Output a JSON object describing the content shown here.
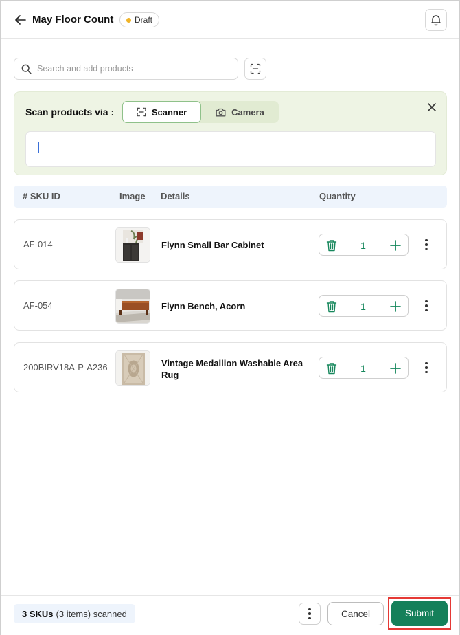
{
  "header": {
    "title": "May Floor Count",
    "status": "Draft",
    "status_color": "#f0b429"
  },
  "search": {
    "placeholder": "Search and add products"
  },
  "scan": {
    "label": "Scan products via :",
    "options": [
      "Scanner",
      "Camera"
    ],
    "selected": "Scanner",
    "input_value": ""
  },
  "table": {
    "headers": [
      "# SKU ID",
      "Image",
      "Details",
      "Quantity"
    ],
    "rows": [
      {
        "sku": "AF-014",
        "name": "Flynn Small Bar Cabinet",
        "qty": "1"
      },
      {
        "sku": "AF-054",
        "name": "Flynn Bench, Acorn",
        "qty": "1"
      },
      {
        "sku": "200BIRV18A-P-A236",
        "name": "Vintage Medallion Washable Area Rug",
        "qty": "1"
      }
    ]
  },
  "footer": {
    "summary_bold": "3 SKUs",
    "summary_rest": "(3 items) scanned",
    "cancel": "Cancel",
    "submit": "Submit"
  },
  "colors": {
    "accent": "#15805a",
    "scan_panel_bg": "#eef4e4",
    "table_header_bg": "#eef4fc",
    "highlight": "#e53935"
  }
}
